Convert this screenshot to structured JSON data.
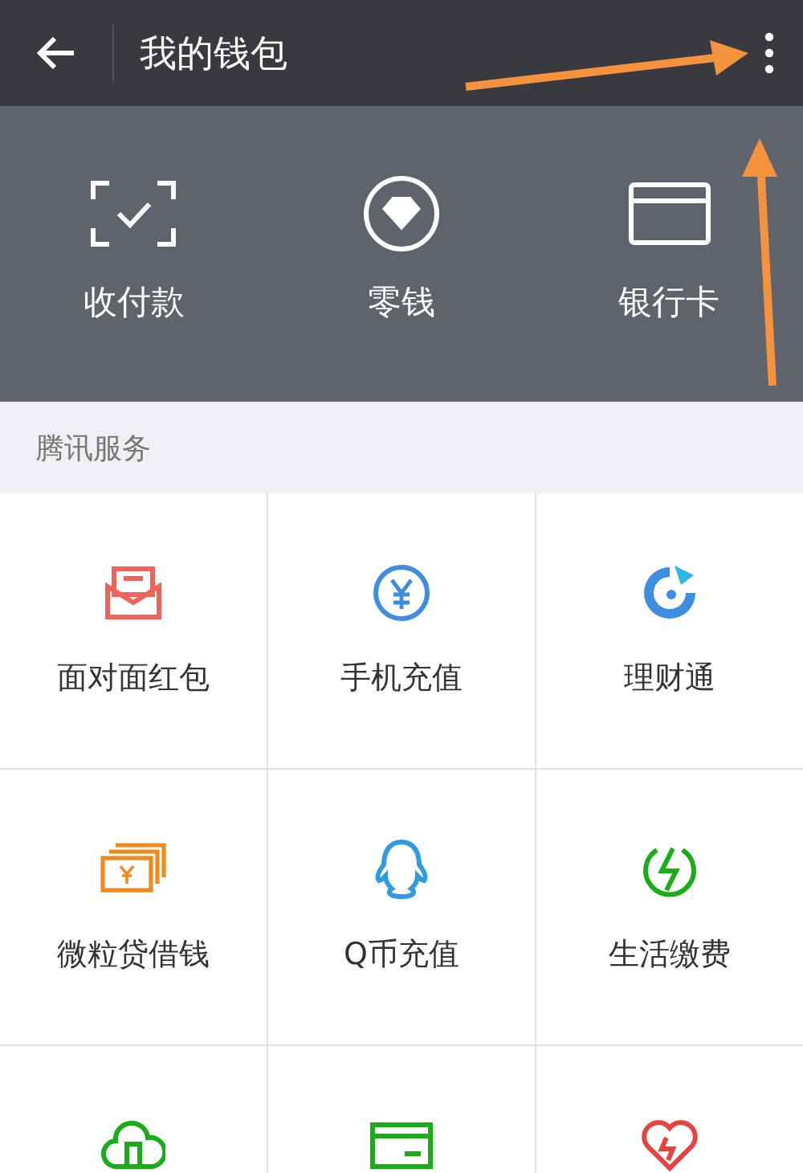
{
  "header": {
    "title": "我的钱包"
  },
  "actions": [
    {
      "label": "收付款",
      "kind": "scan"
    },
    {
      "label": "零钱",
      "kind": "coin"
    },
    {
      "label": "银行卡",
      "kind": "card"
    }
  ],
  "section": {
    "title": "腾讯服务"
  },
  "services": [
    {
      "label": "面对面红包",
      "kind": "envelope"
    },
    {
      "label": "手机充值",
      "kind": "yen"
    },
    {
      "label": "理财通",
      "kind": "finance"
    },
    {
      "label": "微粒贷借钱",
      "kind": "bills"
    },
    {
      "label": "Q币充值",
      "kind": "penguin"
    },
    {
      "label": "生活缴费",
      "kind": "bolt"
    },
    {
      "kind": "cloud"
    },
    {
      "kind": "screen"
    },
    {
      "kind": "heart"
    }
  ]
}
